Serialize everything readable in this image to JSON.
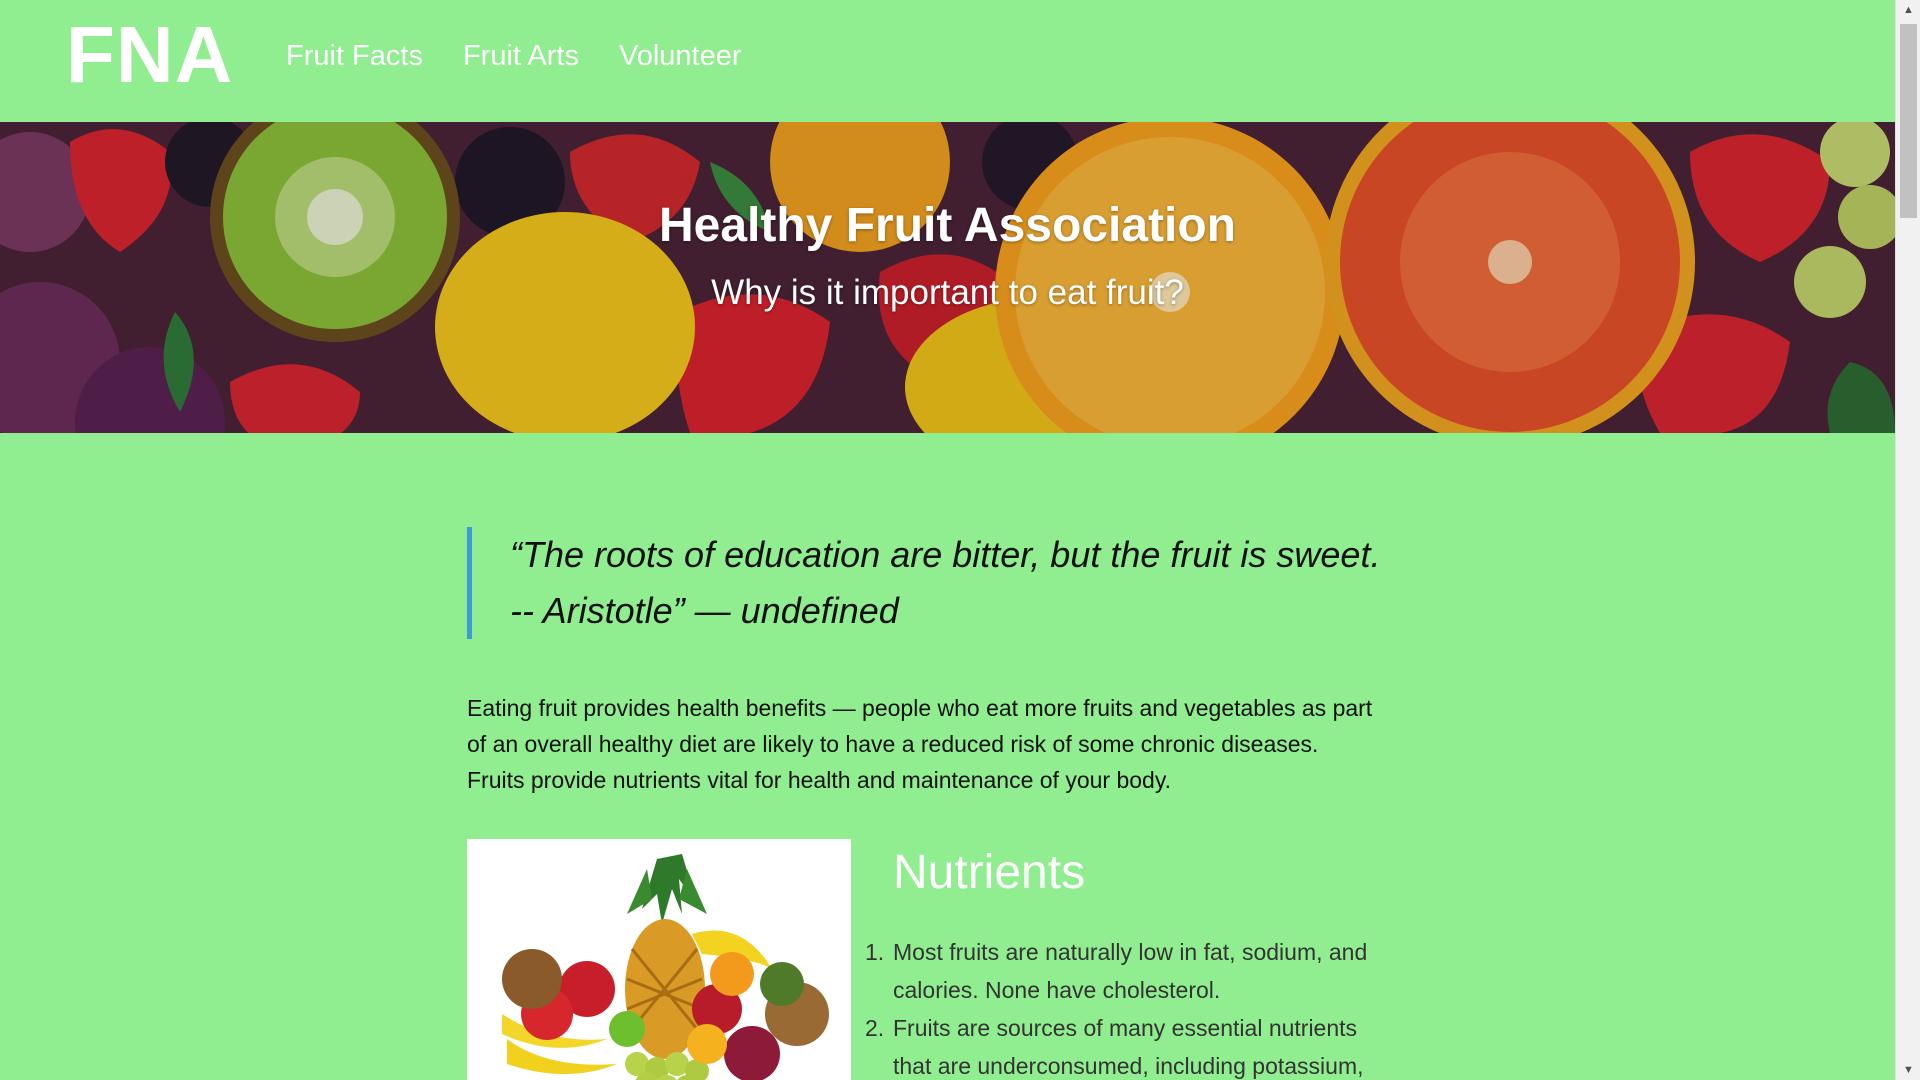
{
  "header": {
    "logo": "FNA",
    "nav": [
      "Fruit Facts",
      "Fruit Arts",
      "Volunteer"
    ]
  },
  "hero": {
    "title": "Healthy Fruit Association",
    "subtitle": "Why is it important to eat fruit?"
  },
  "main": {
    "quote_line1": "“The roots of education are bitter, but the fruit is sweet.",
    "quote_line2": "-- Aristotle” — undefined",
    "intro_line1": "Eating fruit provides health benefits — people who eat more fruits and vegetables as part",
    "intro_line2": "of an overall healthy diet are likely to have a reduced risk of some chronic diseases.",
    "intro_line3": "Fruits provide nutrients vital for health and maintenance of your body.",
    "nutrients_title": "Nutrients",
    "nutrients": [
      {
        "num": "1.",
        "line1": "Most fruits are naturally low in fat, sodium, and",
        "line2": "calories. None have cholesterol."
      },
      {
        "num": "2.",
        "line1": "Fruits are sources of many essential nutrients",
        "line2": "that are underconsumed, including potassium,"
      }
    ]
  },
  "colors": {
    "page_background": "#90ee90",
    "quote_border": "#3e9bd5",
    "heading_text": "#ffffff"
  },
  "icons": {
    "scroll_up": "scroll-up-arrow-icon",
    "scroll_down": "scroll-down-arrow-icon"
  }
}
